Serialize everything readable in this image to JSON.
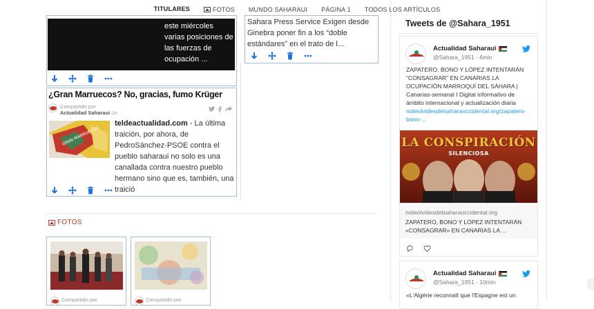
{
  "topnav": {
    "items": [
      {
        "label": "TITULARES",
        "active": true
      },
      {
        "label": "FOTOS",
        "icon": "picture-icon"
      },
      {
        "label": "MUNDO SAHARAUI"
      },
      {
        "label": "PÁGINA 1"
      },
      {
        "label": "TODOS LOS ARTÍCULOS"
      }
    ]
  },
  "card_top_left": {
    "text_lines": [
      "este miércoles",
      "varias posiciones de",
      "las fuerzas de",
      "ocupación ..."
    ]
  },
  "card_top_right": {
    "text": "Sahara Press Service Exigen desde Ginebra poner fin a los “doble estándares” en el trato de l..."
  },
  "post": {
    "title": "¿Gran Marruecos? No, gracias, fumo Krüger",
    "shared_label": "Compartido por",
    "shared_by": "Actualidad Saharaui",
    "shared_suffix": "DH",
    "source": "teldeactualidad.com",
    "excerpt": " - La última traición, por ahora, de PedroSánchez-PSOE contra el pueblo saharaui no solo es una canallada contra nuestro pueblo hermano sino que es, también, una traició"
  },
  "fotos": {
    "title": "FOTOS",
    "shared_label": "Compartido por"
  },
  "twitter": {
    "header": "Tweets de @Sahara_1951",
    "tweets": [
      {
        "name": "Actualidad Saharaui",
        "handle": "@Sahara_1951 · 6min",
        "text": "ZAPATERO, BONO Y LÓPEZ INTENTARÁN “CONSAGRAR” EN CANARIAS LA OCUPACIÓN MARROQUÍ DEL SÁHARA | Canarias-semanal I Digital informativo de ámbito internacional y actualización diaria ",
        "link": "noteolvidesdelsaharaoccidental.org/zapatero-bono-...",
        "image_title": "LA CONSPIRACIÓN",
        "image_subtitle": "SILENCIOSA",
        "card_domain": "noteolvidesdelsaharaoccidental.org",
        "card_title": "ZAPATERO, BONO Y LÓPEZ INTENTARÁN «CONSAGRAR» EN CANARIAS LA ..."
      },
      {
        "name": "Actualidad Saharaui",
        "handle": "@Sahara_1951 · 10min",
        "text": "«L'Algérie reconnaît que l'Espagne est un"
      }
    ]
  },
  "colors": {
    "accent": "#c0392b",
    "card_border": "#9db9e6",
    "tool_blue": "#1e6fd9",
    "twitter_blue": "#1d9bf0"
  }
}
